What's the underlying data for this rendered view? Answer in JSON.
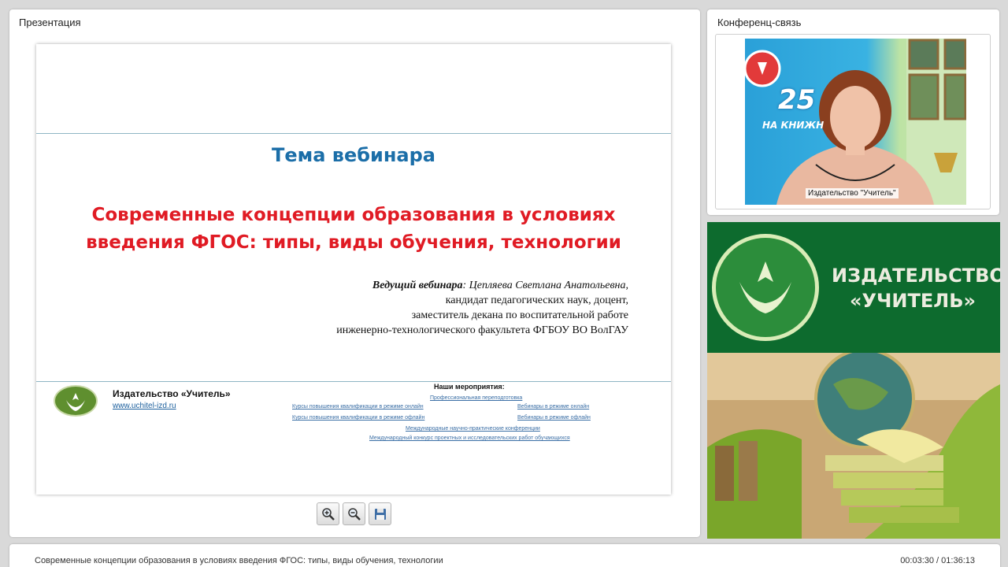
{
  "presentation": {
    "panel_title": "Презентация",
    "slide": {
      "topic": "Тема вебинара",
      "title_line1": "Современные концепции образования в условиях",
      "title_line2": "введения ФГОС: типы, виды обучения, технологии",
      "host_label": "Ведущий вебинара",
      "host_name": ":  Цепляева Светлана Анатольевна,",
      "host_line2": "кандидат педагогических наук,  доцент,",
      "host_line3": "заместитель декана по воспитательной работе",
      "host_line4": "инженерно-технологического факультета  ФГБОУ ВО ВолГАУ",
      "publisher": "Издательство «Учитель»",
      "url": "www.uchitel-izd.ru",
      "events_title": "Наши мероприятия:",
      "events": [
        "Профессиональная переподготовка",
        "Курсы повышения квалификации в режиме онлайн",
        "Вебинары в режиме онлайн",
        "Курсы повышения квалификации в режиме офлайн",
        "Вебинары в режиме офлайн",
        "Международные научно-практические конференции",
        "Международный конкурс проектных и исследовательских работ обучающихся"
      ]
    },
    "tools": [
      "zoom-in",
      "zoom-out",
      "save"
    ]
  },
  "conference": {
    "panel_title": "Конференц-связь",
    "poster_text": "25",
    "poster_sub": "НА КНИЖН",
    "caption": "Издательство \"Учитель\""
  },
  "banner": {
    "line1": "ИЗДАТЕЛЬСТВО",
    "line2": "«УЧИТЕЛЬ»"
  },
  "footer": {
    "title": "Современные концепции образования в условиях введения ФГОС: типы, виды обучения, технологии",
    "time": "00:03:30 / 01:36:13"
  },
  "colors": {
    "topic": "#1b6ea8",
    "title": "#e01b24",
    "banner_bg": "#0d6b2e"
  }
}
